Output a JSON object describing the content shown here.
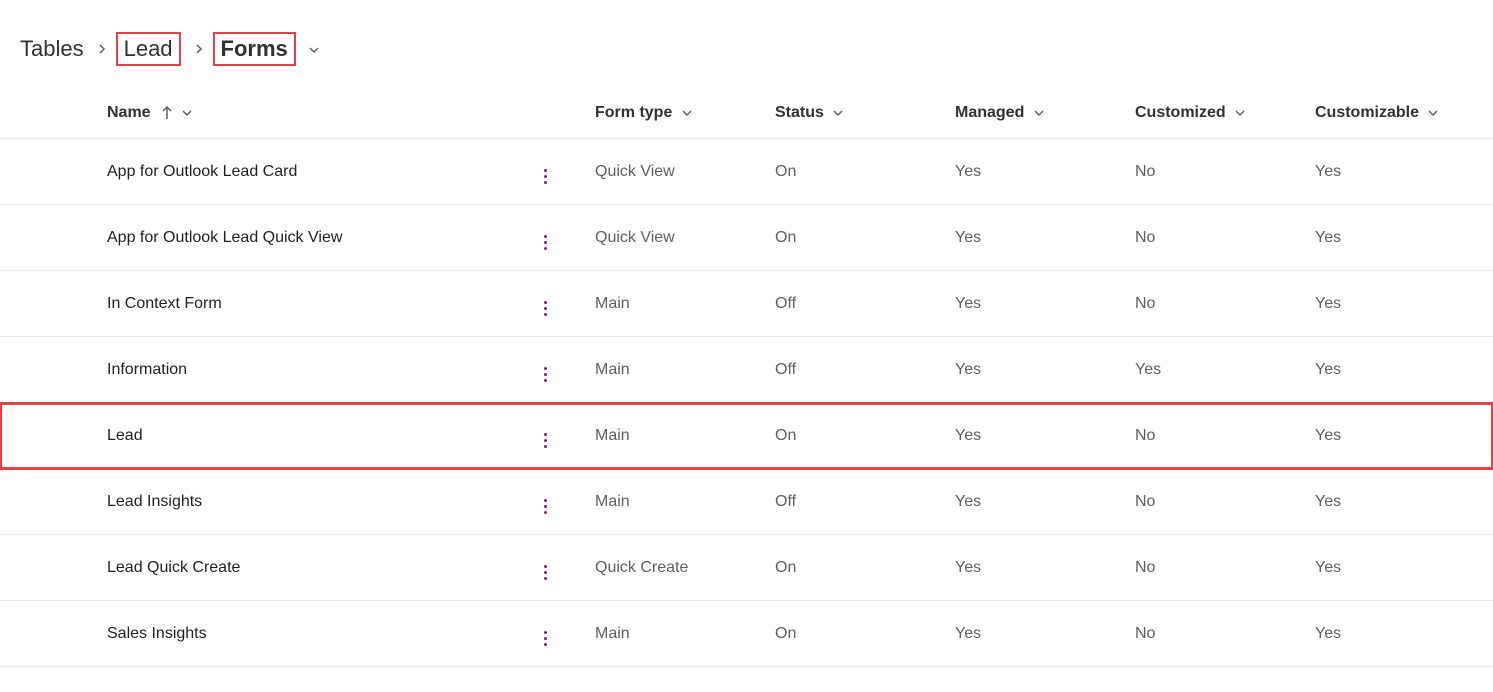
{
  "breadcrumb": {
    "root": "Tables",
    "entity": "Lead",
    "current": "Forms"
  },
  "columns": {
    "name": "Name",
    "form_type": "Form type",
    "status": "Status",
    "managed": "Managed",
    "customized": "Customized",
    "customizable": "Customizable"
  },
  "rows": [
    {
      "name": "App for Outlook Lead Card",
      "form_type": "Quick View",
      "status": "On",
      "managed": "Yes",
      "customized": "No",
      "customizable": "Yes",
      "highlight": false
    },
    {
      "name": "App for Outlook Lead Quick View",
      "form_type": "Quick View",
      "status": "On",
      "managed": "Yes",
      "customized": "No",
      "customizable": "Yes",
      "highlight": false
    },
    {
      "name": "In Context Form",
      "form_type": "Main",
      "status": "Off",
      "managed": "Yes",
      "customized": "No",
      "customizable": "Yes",
      "highlight": false
    },
    {
      "name": "Information",
      "form_type": "Main",
      "status": "Off",
      "managed": "Yes",
      "customized": "Yes",
      "customizable": "Yes",
      "highlight": false
    },
    {
      "name": "Lead",
      "form_type": "Main",
      "status": "On",
      "managed": "Yes",
      "customized": "No",
      "customizable": "Yes",
      "highlight": true
    },
    {
      "name": "Lead Insights",
      "form_type": "Main",
      "status": "Off",
      "managed": "Yes",
      "customized": "No",
      "customizable": "Yes",
      "highlight": false
    },
    {
      "name": "Lead Quick Create",
      "form_type": "Quick Create",
      "status": "On",
      "managed": "Yes",
      "customized": "No",
      "customizable": "Yes",
      "highlight": false
    },
    {
      "name": "Sales Insights",
      "form_type": "Main",
      "status": "On",
      "managed": "Yes",
      "customized": "No",
      "customizable": "Yes",
      "highlight": false
    }
  ]
}
